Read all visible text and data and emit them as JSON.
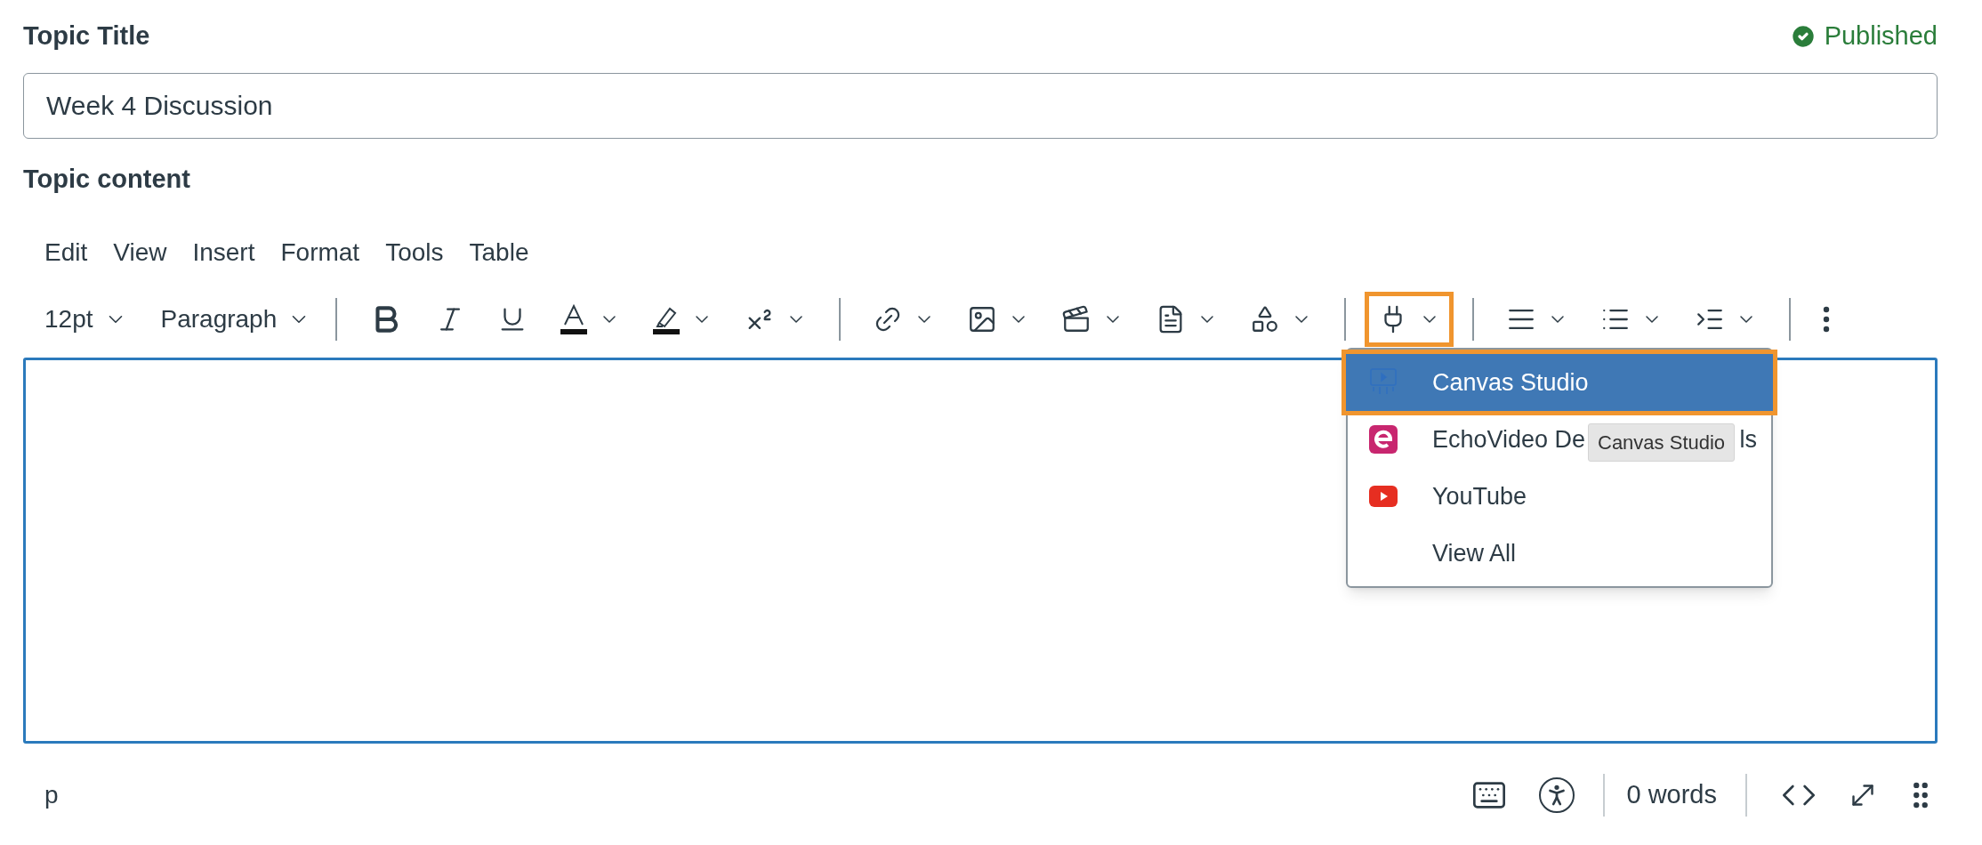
{
  "topic_title": {
    "label": "Topic Title",
    "value": "Week 4 Discussion"
  },
  "status": {
    "label": "Published",
    "published": true
  },
  "content_label": "Topic content",
  "menubar": [
    "Edit",
    "View",
    "Insert",
    "Format",
    "Tools",
    "Table"
  ],
  "toolbar": {
    "font_size": "12pt",
    "block_format": "Paragraph",
    "tools": [
      {
        "kind": "separator"
      },
      {
        "kind": "bold",
        "menu": false,
        "highlighted": false
      },
      {
        "kind": "italic",
        "menu": false,
        "highlighted": false
      },
      {
        "kind": "underline",
        "menu": false,
        "highlighted": false
      },
      {
        "kind": "text-color",
        "menu": true,
        "highlighted": false
      },
      {
        "kind": "highlight",
        "menu": true,
        "highlighted": false
      },
      {
        "kind": "superscript",
        "menu": true,
        "highlighted": false
      },
      {
        "kind": "separator"
      },
      {
        "kind": "link",
        "menu": true,
        "highlighted": false
      },
      {
        "kind": "image",
        "menu": true,
        "highlighted": false
      },
      {
        "kind": "media",
        "menu": true,
        "highlighted": false
      },
      {
        "kind": "document",
        "menu": true,
        "highlighted": false
      },
      {
        "kind": "apps",
        "menu": true,
        "highlighted": false
      },
      {
        "kind": "separator"
      },
      {
        "kind": "plugin",
        "menu": true,
        "highlighted": true
      },
      {
        "kind": "separator"
      },
      {
        "kind": "align",
        "menu": true,
        "highlighted": false
      },
      {
        "kind": "list",
        "menu": true,
        "highlighted": false
      },
      {
        "kind": "indent",
        "menu": true,
        "highlighted": false
      },
      {
        "kind": "separator"
      },
      {
        "kind": "more",
        "menu": false,
        "highlighted": false
      }
    ]
  },
  "dropdown": {
    "items": [
      {
        "kind": "studio",
        "label": "Canvas Studio",
        "selected": true
      },
      {
        "kind": "echo",
        "label": "EchoVideo De",
        "label_end": "ls",
        "selected": false
      },
      {
        "kind": "youtube",
        "label": "YouTube",
        "selected": false
      },
      {
        "kind": "none",
        "label": "View All",
        "selected": false
      }
    ]
  },
  "tooltip": {
    "text": "Canvas Studio"
  },
  "status_bar": {
    "path": "p",
    "word_count": "0 words"
  }
}
